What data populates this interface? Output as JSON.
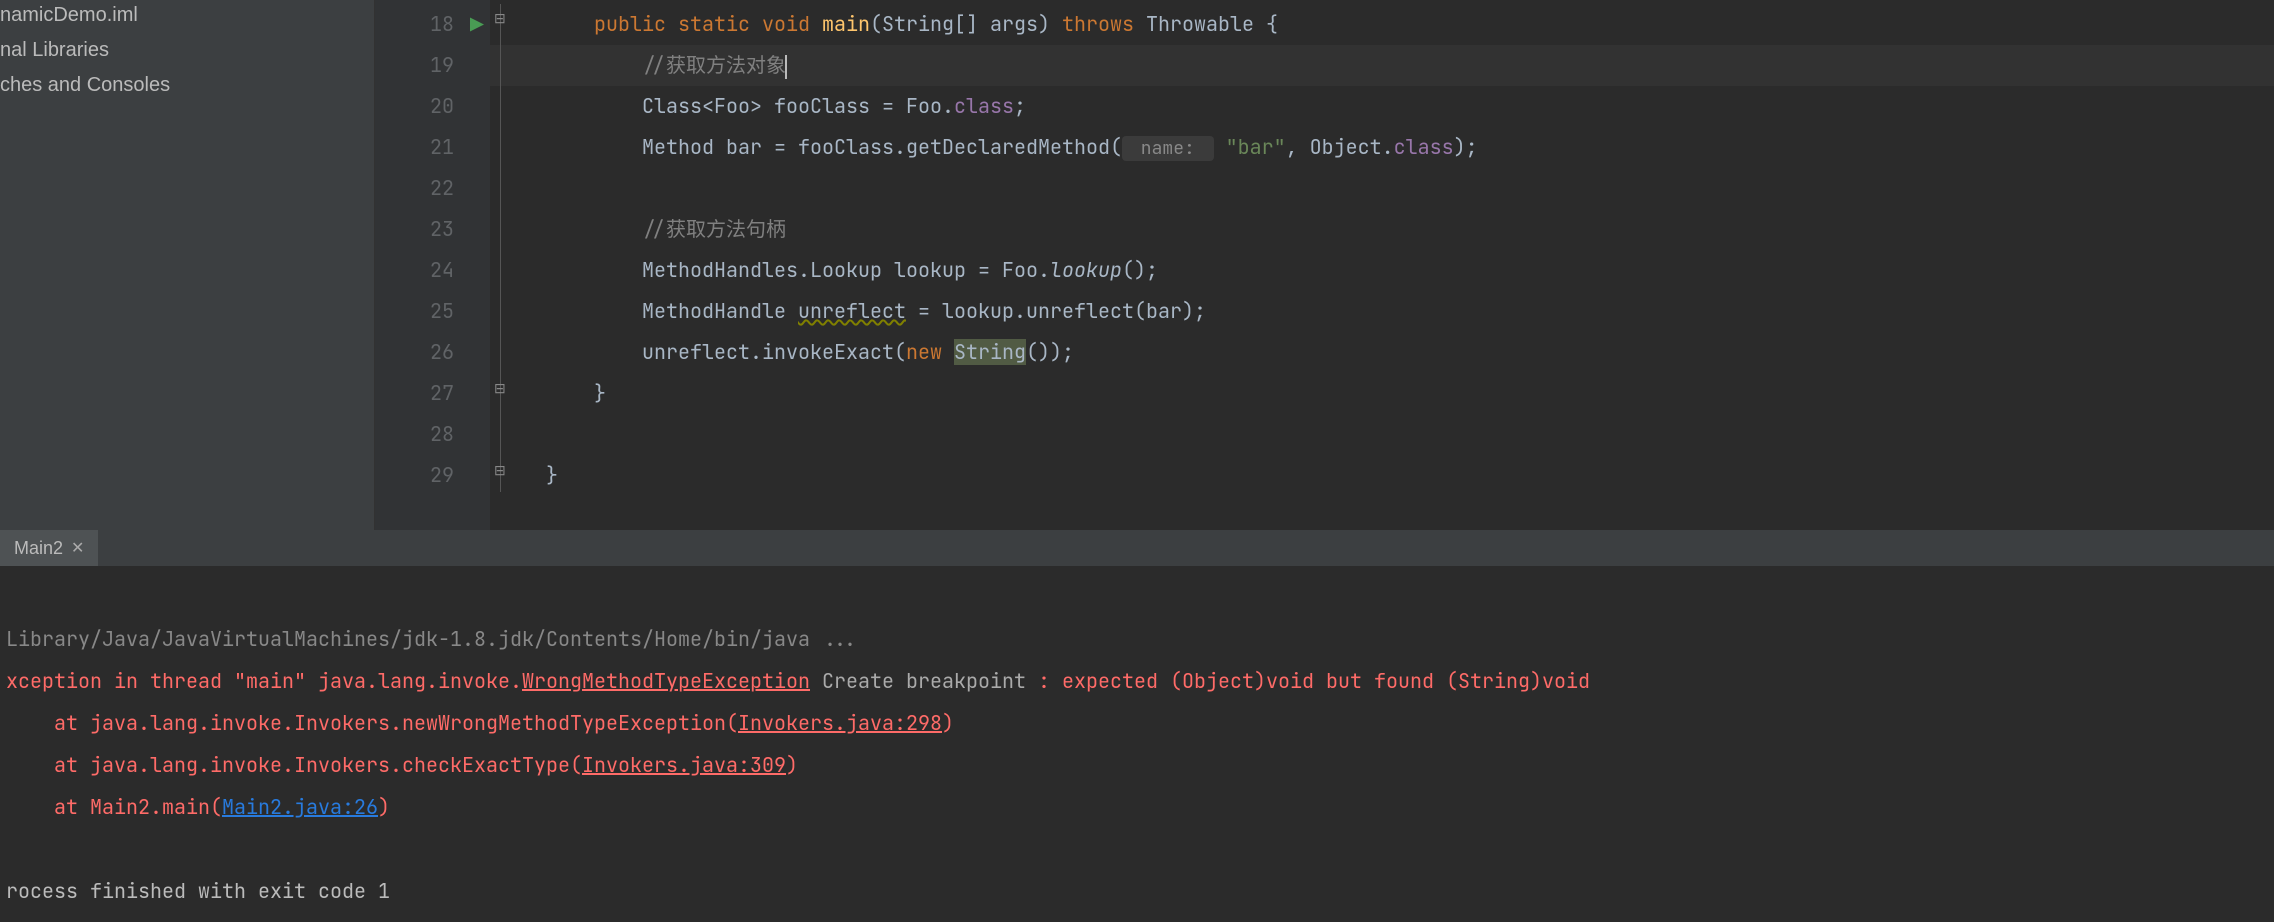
{
  "sidebar": {
    "items": [
      {
        "label": "namicDemo.iml"
      },
      {
        "label": "nal Libraries"
      },
      {
        "label": "ches and Consoles"
      }
    ]
  },
  "editor": {
    "lines": [
      {
        "num": "18"
      },
      {
        "num": "19"
      },
      {
        "num": "20"
      },
      {
        "num": "21"
      },
      {
        "num": "22"
      },
      {
        "num": "23"
      },
      {
        "num": "24"
      },
      {
        "num": "25"
      },
      {
        "num": "26"
      },
      {
        "num": "27"
      },
      {
        "num": "28"
      },
      {
        "num": "29"
      }
    ],
    "l18": {
      "kw_public": "public",
      "kw_static": "static",
      "kw_void": "void",
      "method": "main",
      "params": "(String[] args) ",
      "kw_throws": "throws",
      "tail": " Throwable {"
    },
    "l19": {
      "comment": "//获取方法对象"
    },
    "l20": {
      "pre": "Class<Foo> fooClass = Foo.",
      "field": "class",
      "tail": ";"
    },
    "l21": {
      "pre": "Method bar = fooClass.getDeclaredMethod(",
      "hint": " name: ",
      "str": "\"bar\"",
      "mid": ", Object.",
      "field": "class",
      "tail": ");"
    },
    "l23": {
      "comment": "//获取方法句柄"
    },
    "l24": {
      "pre": "MethodHandles.Lookup lookup = Foo.",
      "call": "lookup",
      "tail": "();"
    },
    "l25": {
      "pre": "MethodHandle ",
      "warn": "unreflect",
      "tail": " = lookup.unreflect(bar);"
    },
    "l26": {
      "pre": "unreflect.invokeExact(",
      "kw_new": "new",
      "sp": " ",
      "hl": "String",
      "tail": "());"
    },
    "l27": {
      "text": "}"
    },
    "l29": {
      "text": "}"
    }
  },
  "run": {
    "tab": "Main2",
    "cmd": "Library/Java/JavaVirtualMachines/jdk-1.8.jdk/Contents/Home/bin/java ...",
    "ex_pre": "xception in thread \"main\" java.lang.invoke.",
    "ex_link": "WrongMethodTypeException",
    "ex_hint": "Create breakpoint",
    "ex_tail": " : expected (Object)void but found (String)void",
    "st1_pre": "    at java.lang.invoke.Invokers.newWrongMethodTypeException(",
    "st1_link": "Invokers.java:298",
    "st1_tail": ")",
    "st2_pre": "    at java.lang.invoke.Invokers.checkExactType(",
    "st2_link": "Invokers.java:309",
    "st2_tail": ")",
    "st3_pre": "    at Main2.main(",
    "st3_link": "Main2.java:26",
    "st3_tail": ")",
    "exit": "rocess finished with exit code 1"
  }
}
